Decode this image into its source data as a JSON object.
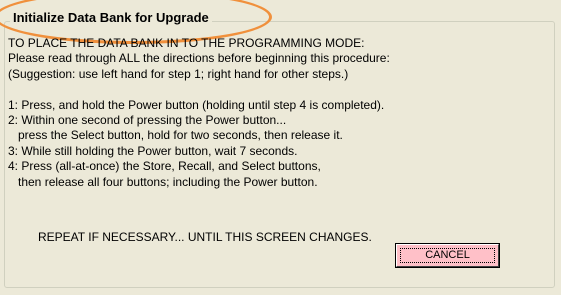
{
  "dialog": {
    "group_title": "Initialize Data Bank for Upgrade",
    "lines": [
      "TO PLACE THE DATA BANK IN TO THE PROGRAMMING MODE:",
      "Please read through ALL the directions before beginning this procedure:",
      "(Suggestion: use left hand for step 1; right hand for other steps.)",
      "",
      "1: Press, and hold the Power button (holding until step 4 is completed).",
      "2: Within one second of pressing the Power button...",
      "   press the Select button, hold for two seconds, then release it.",
      "3: While still holding the Power button, wait 7 seconds.",
      "4: Press (all-at-once) the Store, Recall, and Select buttons,",
      "   then release all four buttons; including the Power button."
    ],
    "repeat_text": "REPEAT IF NECESSARY... UNTIL THIS SCREEN CHANGES.",
    "cancel_label": "CANCEL"
  },
  "colors": {
    "background": "#ece9d8",
    "cancel_button": "#ffc0c8",
    "annotation_oval": "#f0903c"
  }
}
